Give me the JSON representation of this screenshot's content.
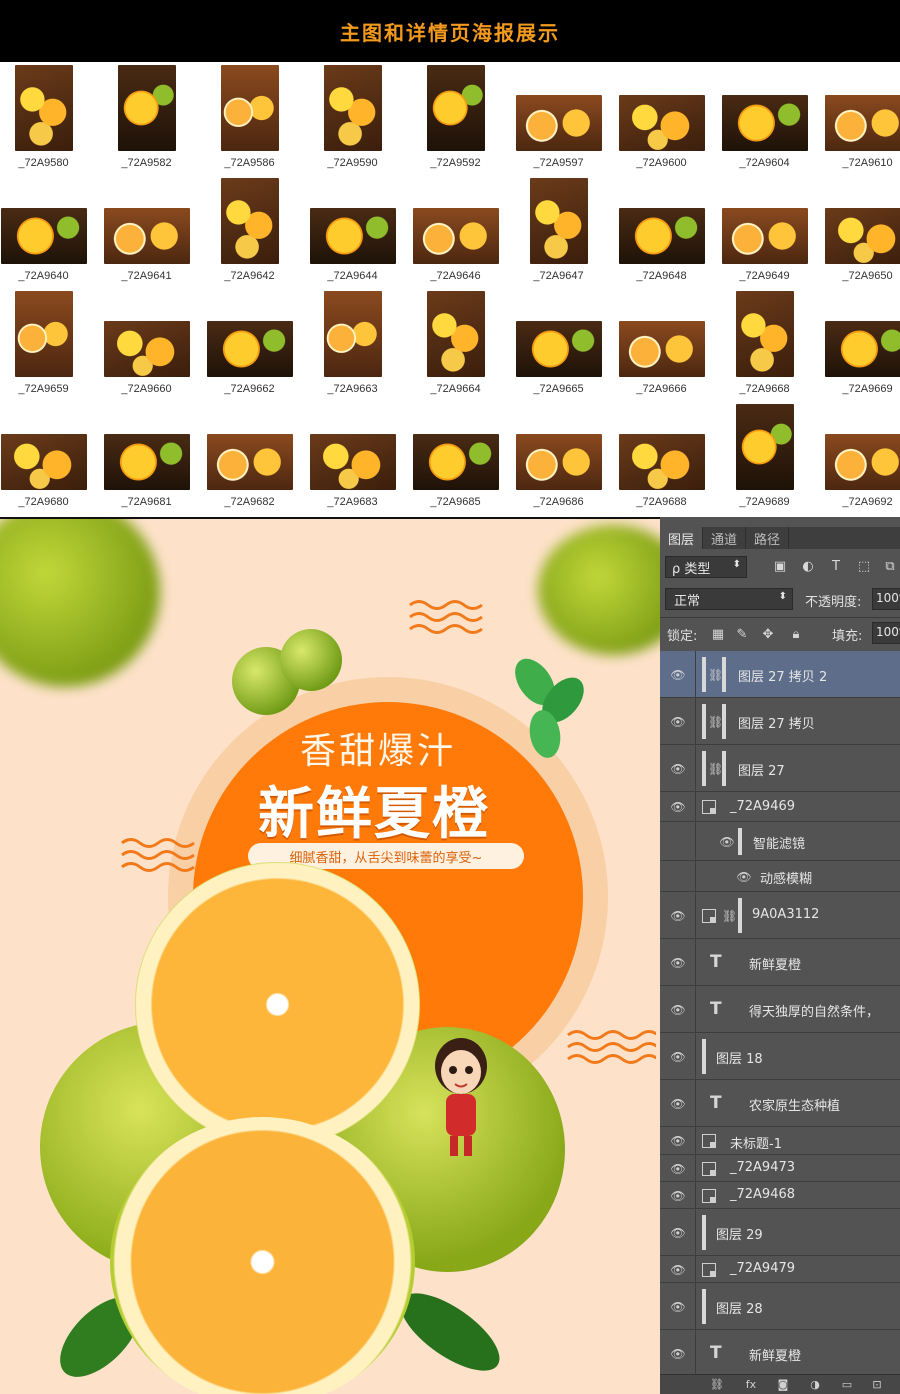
{
  "header": {
    "title": "主图和详情页海报展示"
  },
  "thumbnails": [
    [
      "_72A9580",
      "_72A9582",
      "_72A9586",
      "_72A9590",
      "_72A9592",
      "_72A9597",
      "_72A9600",
      "_72A9604",
      "_72A9610"
    ],
    [
      "_72A9640",
      "_72A9641",
      "_72A9642",
      "_72A9644",
      "_72A9646",
      "_72A9647",
      "_72A9648",
      "_72A9649",
      "_72A9650"
    ],
    [
      "_72A9659",
      "_72A9660",
      "_72A9662",
      "_72A9663",
      "_72A9664",
      "_72A9665",
      "_72A9666",
      "_72A9668",
      "_72A9669"
    ],
    [
      "_72A9680",
      "_72A9681",
      "_72A9682",
      "_72A9683",
      "_72A9685",
      "_72A9686",
      "_72A9688",
      "_72A9689",
      "_72A9692"
    ]
  ],
  "poster": {
    "subtitle": "香甜爆汁",
    "title": "新鲜夏橙",
    "tagline": "细腻香甜，从舌尖到味蕾的享受~",
    "colors": {
      "background": "#fde2c9",
      "circle": "#ff7a08",
      "ring": "#f9cfa5"
    }
  },
  "panel": {
    "tabs": [
      "图层",
      "通道",
      "路径"
    ],
    "kind_filter": "ρ 类型",
    "blend_mode": "正常",
    "opacity_label": "不透明度:",
    "opacity_value": "100%",
    "lock_label": "锁定:",
    "fill_label": "填充:",
    "fill_value": "100%",
    "layers": [
      {
        "name": "图层 27 拷贝 2",
        "kind": "linked",
        "selected": true
      },
      {
        "name": "图层 27 拷贝",
        "kind": "linked"
      },
      {
        "name": "图层 27",
        "kind": "linked"
      },
      {
        "name": "_72A9469",
        "kind": "smart"
      },
      {
        "name": "智能滤镜",
        "kind": "filter"
      },
      {
        "name": "动感模糊",
        "kind": "filter-item"
      },
      {
        "name": "9A0A3112",
        "kind": "smart-linked"
      },
      {
        "name": "新鲜夏橙",
        "kind": "text"
      },
      {
        "name": "得天独厚的自然条件，",
        "kind": "text"
      },
      {
        "name": "图层 18",
        "kind": "pixel"
      },
      {
        "name": "农家原生态种植",
        "kind": "text"
      },
      {
        "name": "未标题-1",
        "kind": "smart"
      },
      {
        "name": "_72A9473",
        "kind": "smart"
      },
      {
        "name": "_72A9468",
        "kind": "smart"
      },
      {
        "name": "图层 29",
        "kind": "pixel"
      },
      {
        "name": "_72A9479",
        "kind": "smart"
      },
      {
        "name": "图层 28",
        "kind": "pixel"
      },
      {
        "name": "新鲜夏橙",
        "kind": "text"
      }
    ],
    "bottom_icons": [
      "link-icon",
      "fx-icon",
      "mask-icon",
      "adjustment-icon",
      "group-icon",
      "new-layer-icon"
    ]
  }
}
